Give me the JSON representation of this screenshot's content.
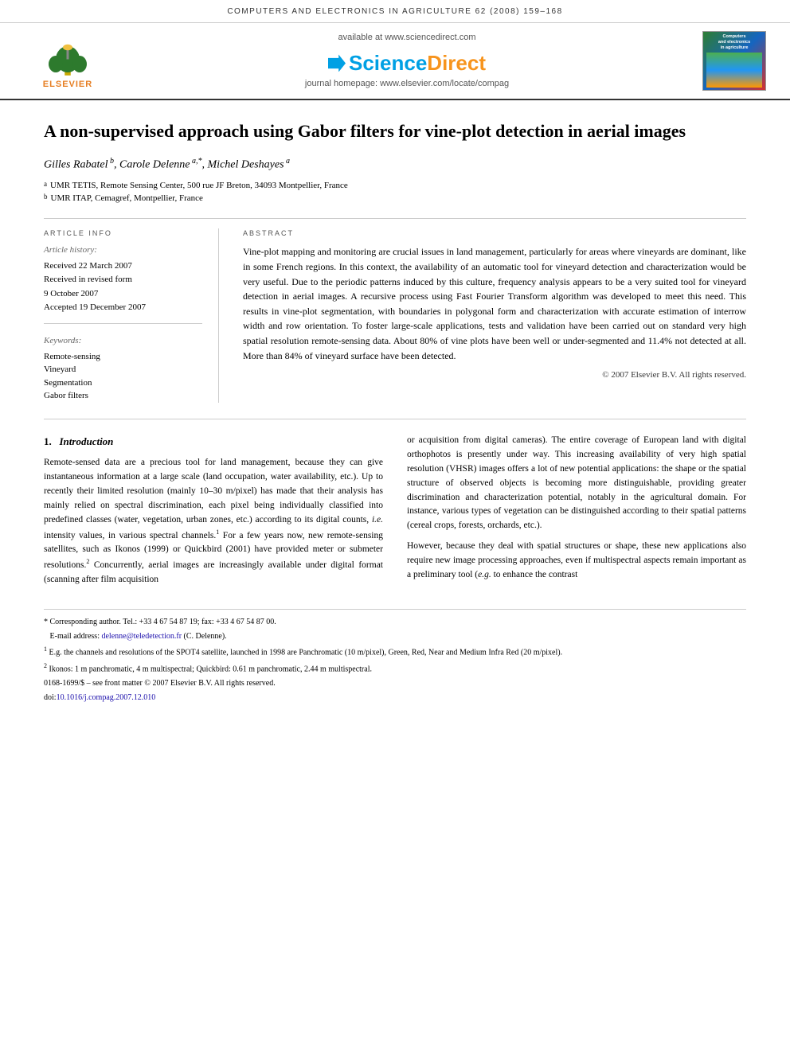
{
  "journal_header": {
    "text": "COMPUTERS AND ELECTRONICS IN AGRICULTURE 62 (2008) 159–168"
  },
  "banner": {
    "available_text": "available at www.sciencedirect.com",
    "sciencedirect_label": "ScienceDirect",
    "homepage_text": "journal homepage: www.elsevier.com/locate/compag",
    "elsevier_label": "ELSEVIER",
    "journal_cover_title": "Computers and electronics in agriculture"
  },
  "article": {
    "title": "A non-supervised approach using Gabor filters for vine-plot detection in aerial images",
    "authors": "Gilles Rabatel b, Carole Delenne a,*, Michel Deshayes a",
    "author1_name": "Gilles Rabatel",
    "author1_super": "b",
    "author2_name": "Carole Delenne",
    "author2_super": "a,*",
    "author3_name": "Michel Deshayes",
    "author3_super": "a",
    "affiliations": [
      {
        "super": "a",
        "text": "UMR TETIS, Remote Sensing Center, 500 rue JF Breton, 34093 Montpellier, France"
      },
      {
        "super": "b",
        "text": "UMR ITAP, Cemagref, Montpellier, France"
      }
    ]
  },
  "article_info": {
    "section_title": "ARTICLE INFO",
    "history_label": "Article history:",
    "received1": "Received 22 March 2007",
    "received2": "Received in revised form",
    "received2_date": "9 October 2007",
    "accepted": "Accepted 19 December 2007",
    "keywords_label": "Keywords:",
    "keywords": [
      "Remote-sensing",
      "Vineyard",
      "Segmentation",
      "Gabor filters"
    ]
  },
  "abstract": {
    "section_title": "ABSTRACT",
    "text": "Vine-plot mapping and monitoring are crucial issues in land management, particularly for areas where vineyards are dominant, like in some French regions. In this context, the availability of an automatic tool for vineyard detection and characterization would be very useful. Due to the periodic patterns induced by this culture, frequency analysis appears to be a very suited tool for vineyard detection in aerial images. A recursive process using Fast Fourier Transform algorithm was developed to meet this need. This results in vine-plot segmentation, with boundaries in polygonal form and characterization with accurate estimation of interrow width and row orientation. To foster large-scale applications, tests and validation have been carried out on standard very high spatial resolution remote-sensing data. About 80% of vine plots have been well or under-segmented and 11.4% not detected at all. More than 84% of vineyard surface have been detected.",
    "copyright": "© 2007 Elsevier B.V. All rights reserved."
  },
  "section1": {
    "number": "1.",
    "title": "Introduction",
    "paragraphs": [
      "Remote-sensed data are a precious tool for land management, because they can give instantaneous information at a large scale (land occupation, water availability, etc.). Up to recently their limited resolution (mainly 10–30 m/pixel) has made that their analysis has mainly relied on spectral discrimination, each pixel being individually classified into predefined classes (water, vegetation, urban zones, etc.) according to its digital counts, i.e. intensity values, in various spectral channels.1 For a few years now, new remote-sensing satellites, such as Ikonos (1999) or Quickbird (2001) have provided meter or submeter resolutions.2 Concurrently, aerial images are increasingly available under digital format (scanning after film acquisition",
      "or acquisition from digital cameras). The entire coverage of European land with digital orthophotos is presently under way. This increasing availability of very high spatial resolution (VHSR) images offers a lot of new potential applications: the shape or the spatial structure of observed objects is becoming more distinguishable, providing greater discrimination and characterization potential, notably in the agricultural domain. For instance, various types of vegetation can be distinguished according to their spatial patterns (cereal crops, forests, orchards, etc.).",
      "However, because they deal with spatial structures or shape, these new applications also require new image processing approaches, even if multispectral aspects remain important as a preliminary tool (e.g. to enhance the contrast"
    ]
  },
  "footnotes": [
    {
      "marker": "*",
      "text": "Corresponding author. Tel.: +33 4 67 54 87 19; fax: +33 4 67 54 87 00. E-mail address: delenne@teledetection.fr (C. Delenne)."
    },
    {
      "marker": "1",
      "text": "E.g. the channels and resolutions of the SPOT4 satellite, launched in 1998 are Panchromatic (10 m/pixel), Green, Red, Near and Medium Infra Red (20 m/pixel)."
    },
    {
      "marker": "2",
      "text": "Ikonos: 1 m panchromatic, 4 m multispectral; Quickbird: 0.61 m panchromatic, 2.44 m multispectral."
    },
    {
      "marker": "license",
      "text": "0168-1699/$ – see front matter © 2007 Elsevier B.V. All rights reserved."
    },
    {
      "marker": "doi",
      "text": "doi:10.1016/j.compag.2007.12.010"
    }
  ]
}
